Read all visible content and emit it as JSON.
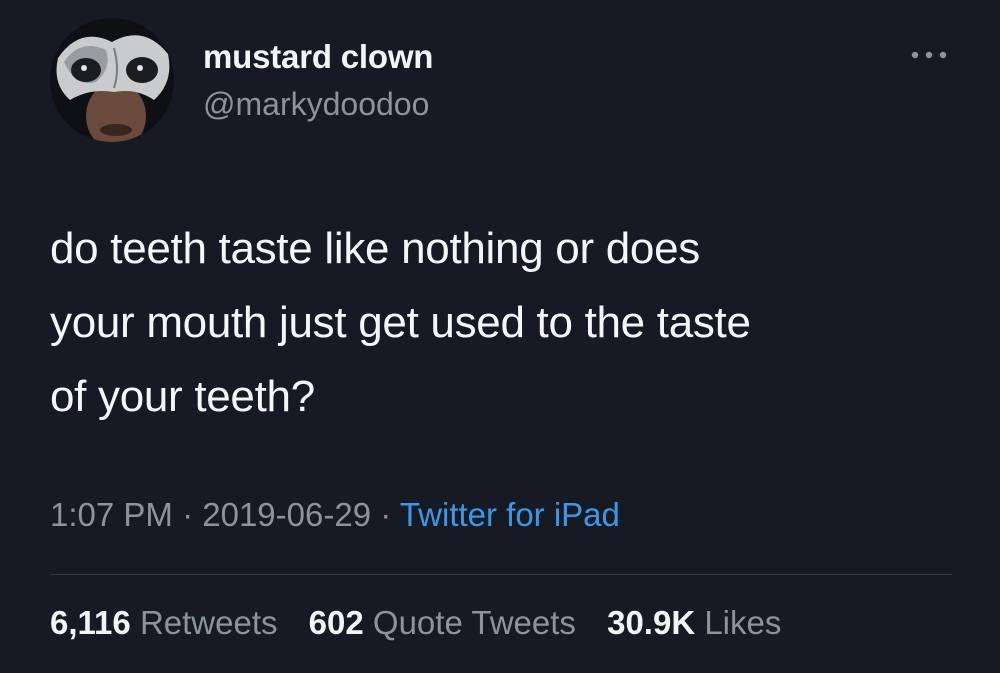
{
  "user": {
    "display_name": "mustard clown",
    "handle": "@markydoodoo",
    "avatar": "avatar-clown-mask"
  },
  "tweet": {
    "text": "do teeth taste like nothing or does\nyour mouth just get used to the taste\nof your teeth?",
    "time": "1:07 PM",
    "date": "2019-06-29",
    "separator": "·",
    "source": "Twitter for iPad"
  },
  "stats": [
    {
      "value": "6,116",
      "label": "Retweets"
    },
    {
      "value": "602",
      "label": "Quote Tweets"
    },
    {
      "value": "30.9K",
      "label": "Likes"
    }
  ],
  "icons": {
    "more": "more-horizontal-icon"
  },
  "colors": {
    "background": "#151a24",
    "text": "#f4f6f8",
    "muted": "#8a949e",
    "link": "#3d97e6",
    "divider": "#2f3641"
  }
}
